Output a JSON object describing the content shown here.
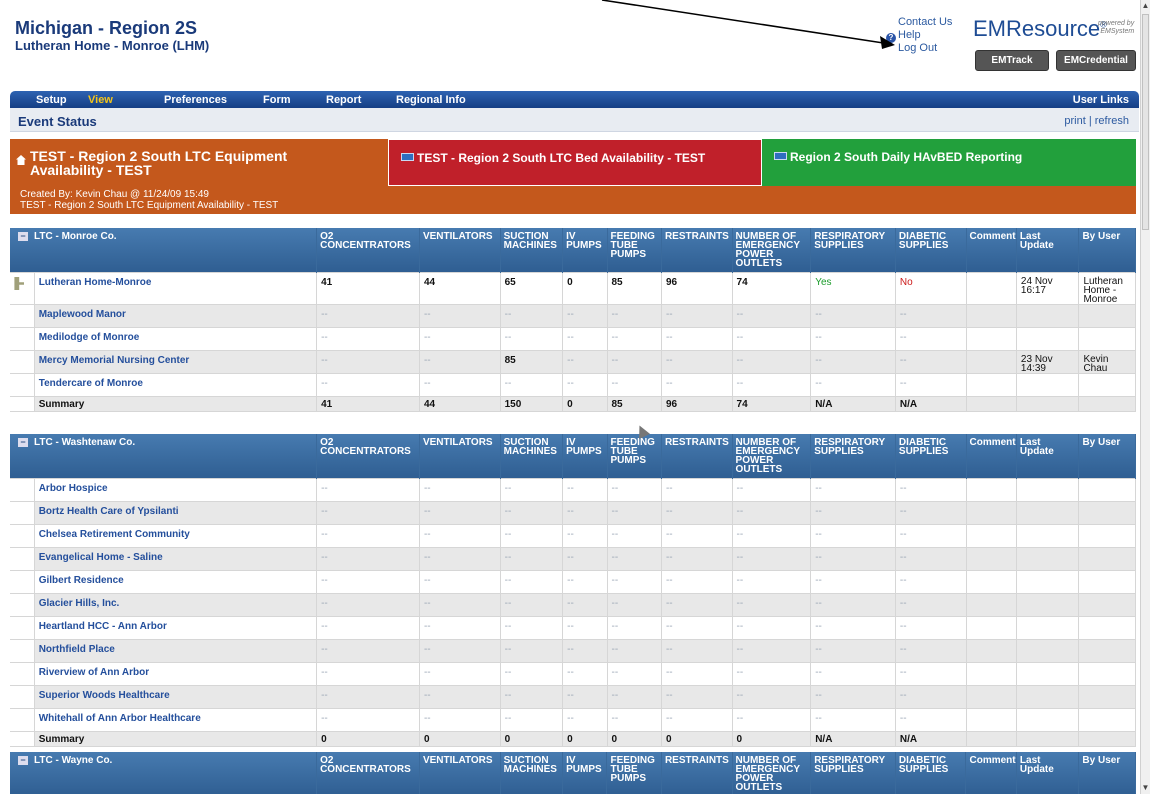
{
  "header": {
    "region": "Michigan - Region 2S",
    "facility": "Lutheran Home - Monroe (LHM)"
  },
  "top_links": {
    "contact": "Contact Us",
    "help": "Help",
    "logout": "Log Out",
    "help_icon_glyph": "?"
  },
  "brand": {
    "name": "EMResource",
    "tm": "®",
    "powered": "powered by",
    "powered2": "EMSystem"
  },
  "buttons": {
    "emtrack": "EMTrack",
    "emcredential": "EMCredential"
  },
  "nav": {
    "items": [
      "Setup",
      "View",
      "Preferences",
      "Form",
      "Report",
      "Regional Info"
    ],
    "user_links": "User Links",
    "active_color": "#f5c518"
  },
  "subbar": {
    "title": "Event Status",
    "print": "print",
    "sep": "|",
    "refresh": "refresh"
  },
  "event_tabs": [
    {
      "label": "TEST - Region 2 South LTC Equipment Availability - TEST",
      "color": "#c4581c",
      "icon": "home-icon"
    },
    {
      "label": "TEST - Region 2 South LTC Bed Availability - TEST",
      "color": "#c0202a",
      "icon": "event-icon"
    },
    {
      "label": "Region 2 South Daily HAvBED Reporting",
      "color": "#22a03c",
      "icon": "event-icon"
    }
  ],
  "event_info": {
    "created": "Created By: Kevin Chau @ 11/24/09 15:49",
    "desc": "TEST - Region 2 South LTC Equipment Availability - TEST"
  },
  "columns": [
    "O2 CONCENTRATORS",
    "VENTILATORS",
    "SUCTION MACHINES",
    "IV PUMPS",
    "FEEDING TUBE PUMPS",
    "RESTRAINTS",
    "NUMBER OF EMERGENCY POWER OUTLETS",
    "RESPIRATORY SUPPLIES",
    "DIABETIC SUPPLIES",
    "Comment",
    "Last Update",
    "By User"
  ],
  "collapse_glyph": "−",
  "summary_label": "Summary",
  "groups": [
    {
      "name": "LTC - Monroe Co.",
      "rows": [
        {
          "name": "Lutheran Home-Monroe",
          "vals": [
            "41",
            "44",
            "65",
            "0",
            "85",
            "96",
            "74",
            "Yes",
            "No",
            "",
            "24 Nov 16:17",
            "Lutheran Home - Monroe"
          ]
        },
        {
          "name": "Maplewood Manor",
          "vals": [
            "--",
            "--",
            "--",
            "--",
            "--",
            "--",
            "--",
            "--",
            "--",
            "",
            "",
            ""
          ]
        },
        {
          "name": "Medilodge of Monroe",
          "vals": [
            "--",
            "--",
            "--",
            "--",
            "--",
            "--",
            "--",
            "--",
            "--",
            "",
            "",
            ""
          ]
        },
        {
          "name": "Mercy Memorial Nursing Center",
          "vals": [
            "--",
            "--",
            "85",
            "--",
            "--",
            "--",
            "--",
            "--",
            "--",
            "",
            "23 Nov 14:39",
            "Kevin Chau"
          ]
        },
        {
          "name": "Tendercare of Monroe",
          "vals": [
            "--",
            "--",
            "--",
            "--",
            "--",
            "--",
            "--",
            "--",
            "--",
            "",
            "",
            ""
          ]
        }
      ],
      "summary": [
        "41",
        "44",
        "150",
        "0",
        "85",
        "96",
        "74",
        "N/A",
        "N/A",
        "",
        "",
        ""
      ]
    },
    {
      "name": "LTC - Washtenaw Co.",
      "rows": [
        {
          "name": "Arbor Hospice",
          "vals": [
            "--",
            "--",
            "--",
            "--",
            "--",
            "--",
            "--",
            "--",
            "--",
            "",
            "",
            ""
          ]
        },
        {
          "name": "Bortz Health Care of Ypsilanti",
          "vals": [
            "--",
            "--",
            "--",
            "--",
            "--",
            "--",
            "--",
            "--",
            "--",
            "",
            "",
            ""
          ]
        },
        {
          "name": "Chelsea Retirement Community",
          "vals": [
            "--",
            "--",
            "--",
            "--",
            "--",
            "--",
            "--",
            "--",
            "--",
            "",
            "",
            ""
          ]
        },
        {
          "name": "Evangelical Home - Saline",
          "vals": [
            "--",
            "--",
            "--",
            "--",
            "--",
            "--",
            "--",
            "--",
            "--",
            "",
            "",
            ""
          ]
        },
        {
          "name": "Gilbert Residence",
          "vals": [
            "--",
            "--",
            "--",
            "--",
            "--",
            "--",
            "--",
            "--",
            "--",
            "",
            "",
            ""
          ]
        },
        {
          "name": "Glacier Hills, Inc.",
          "vals": [
            "--",
            "--",
            "--",
            "--",
            "--",
            "--",
            "--",
            "--",
            "--",
            "",
            "",
            ""
          ]
        },
        {
          "name": "Heartland HCC - Ann Arbor",
          "vals": [
            "--",
            "--",
            "--",
            "--",
            "--",
            "--",
            "--",
            "--",
            "--",
            "",
            "",
            ""
          ]
        },
        {
          "name": "Northfield Place",
          "vals": [
            "--",
            "--",
            "--",
            "--",
            "--",
            "--",
            "--",
            "--",
            "--",
            "",
            "",
            ""
          ]
        },
        {
          "name": "Riverview of Ann Arbor",
          "vals": [
            "--",
            "--",
            "--",
            "--",
            "--",
            "--",
            "--",
            "--",
            "--",
            "",
            "",
            ""
          ]
        },
        {
          "name": "Superior Woods Healthcare",
          "vals": [
            "--",
            "--",
            "--",
            "--",
            "--",
            "--",
            "--",
            "--",
            "--",
            "",
            "",
            ""
          ]
        },
        {
          "name": "Whitehall of Ann Arbor Healthcare",
          "vals": [
            "--",
            "--",
            "--",
            "--",
            "--",
            "--",
            "--",
            "--",
            "--",
            "",
            "",
            ""
          ]
        }
      ],
      "summary": [
        "0",
        "0",
        "0",
        "0",
        "0",
        "0",
        "0",
        "N/A",
        "N/A",
        "",
        "",
        ""
      ]
    },
    {
      "name": "LTC - Wayne Co.",
      "rows": [],
      "summary": null
    }
  ],
  "colors": {
    "nav_dark": "#153e84",
    "table_header": "#2f5e92",
    "yes": "#1c9c2c",
    "no": "#cc1a1a"
  }
}
